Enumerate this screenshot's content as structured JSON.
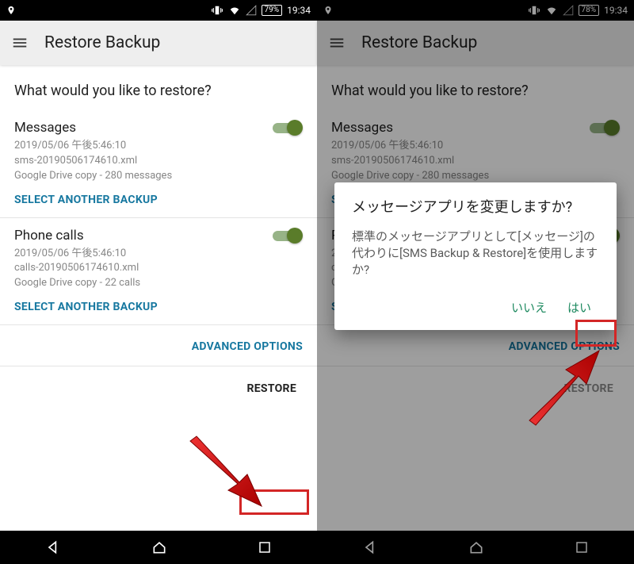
{
  "statusbar": {
    "left": {
      "battery_pct": "79%",
      "time": "19:34"
    },
    "right": {
      "battery_pct": "78%",
      "time": "19:34"
    }
  },
  "appbar": {
    "title": "Restore Backup"
  },
  "question": "What would you like to restore?",
  "sections": {
    "messages": {
      "title": "Messages",
      "date": "2019/05/06 午後5:46:10",
      "file": "sms-20190506174610.xml",
      "source": "Google Drive copy - 280 messages",
      "select_label": "SELECT ANOTHER BACKUP"
    },
    "calls": {
      "title": "Phone calls",
      "date": "2019/05/06 午後5:46:10",
      "file": "calls-20190506174610.xml",
      "source": "Google Drive copy - 22 calls",
      "select_label": "SELECT ANOTHER BACKUP"
    }
  },
  "advanced_label": "ADVANCED OPTIONS",
  "restore_label": "RESTORE",
  "dialog": {
    "title": "メッセージアプリを変更しますか?",
    "body": "標準のメッセージアプリとして[メッセージ]の代わりに[SMS Backup & Restore]を使用しますか?",
    "no": "いいえ",
    "yes": "はい"
  }
}
